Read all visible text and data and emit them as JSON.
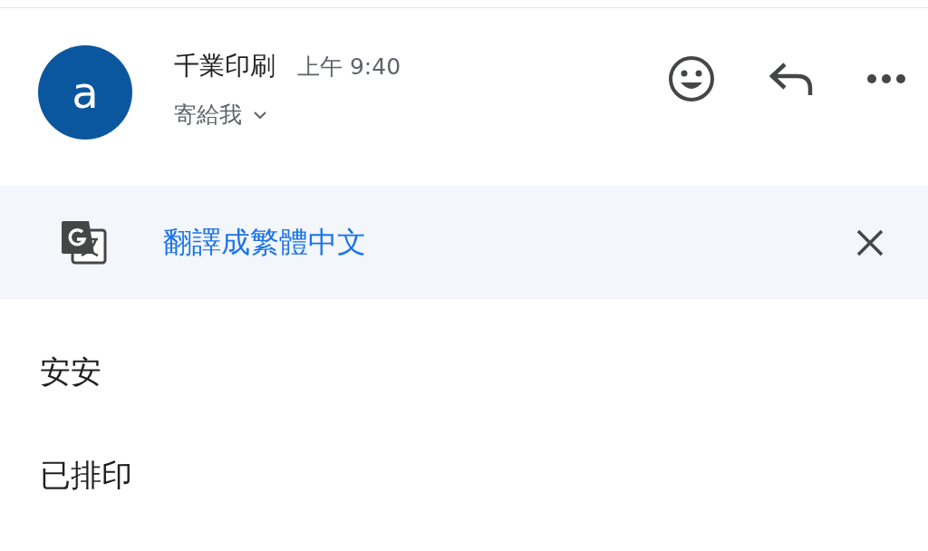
{
  "message": {
    "avatar_letter": "a",
    "sender": "千業印刷",
    "time": "上午 9:40",
    "recipient": "寄給我"
  },
  "translate_bar": {
    "label": "翻譯成繁體中文"
  },
  "body": [
    "安安",
    "已排印"
  ]
}
